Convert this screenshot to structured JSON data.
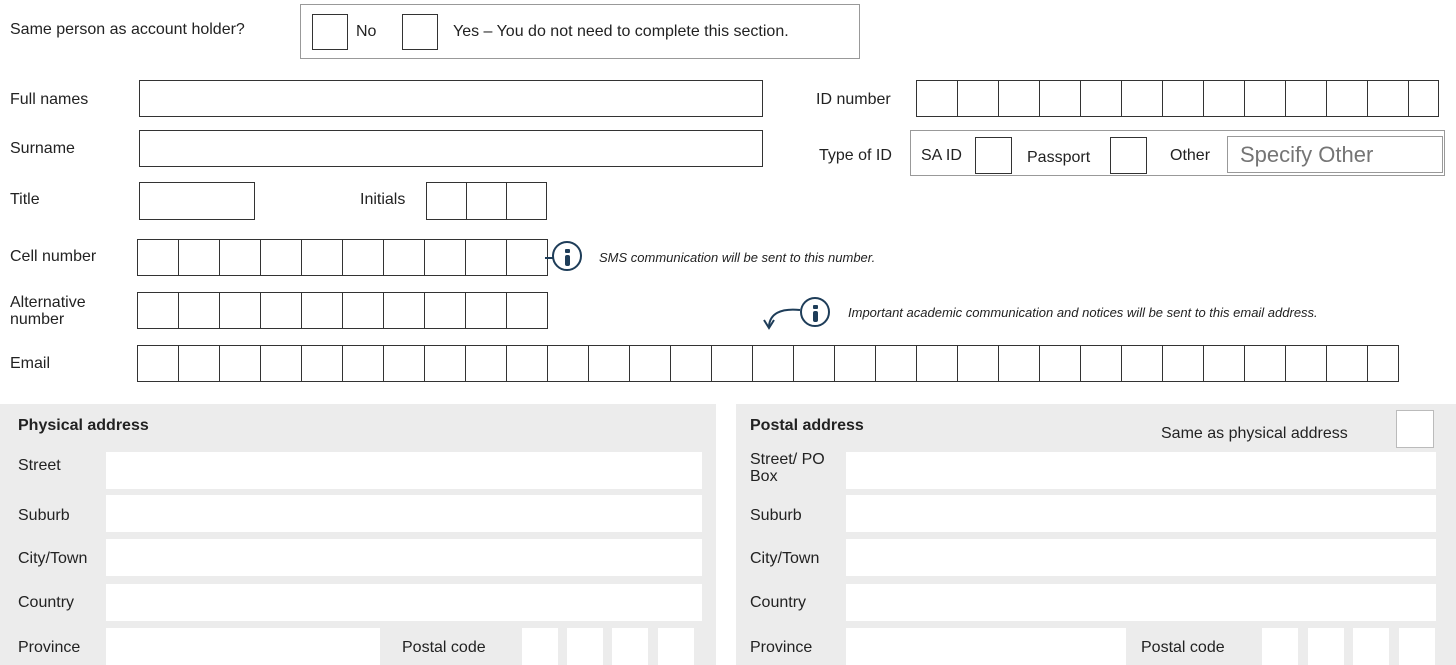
{
  "holder": {
    "question": "Same person as account holder?",
    "no_label": "No",
    "yes_label": "Yes – You do not need to complete this section."
  },
  "fields": {
    "full_names": "Full names",
    "surname": "Surname",
    "title": "Title",
    "initials": "Initials",
    "cell_number": "Cell number",
    "alt_number": "Alternative number",
    "email": "Email",
    "id_number": "ID number",
    "type_of_id": "Type of ID",
    "sa_id": "SA ID",
    "passport": "Passport",
    "other": "Other",
    "specify_other_placeholder": "Specify Other"
  },
  "notes": {
    "sms": "SMS communication will be sent to this number.",
    "email": "Important academic communication and notices will be sent to this email address."
  },
  "icons": {
    "sms_info": "info-icon",
    "email_info": "info-icon",
    "email_arrow": "curved-arrow-down-left-icon"
  },
  "physical": {
    "title": "Physical address",
    "street": "Street",
    "suburb": "Suburb",
    "city": "City/Town",
    "country": "Country",
    "province": "Province",
    "postal_code": "Postal code"
  },
  "postal": {
    "title": "Postal address",
    "same_as": "Same as physical address",
    "street": "Street/ PO Box",
    "suburb": "Suburb",
    "city": "City/Town",
    "country": "Country",
    "province": "Province",
    "postal_code": "Postal code"
  },
  "colors": {
    "accent": "#1e3d59",
    "panel": "#ececec"
  }
}
